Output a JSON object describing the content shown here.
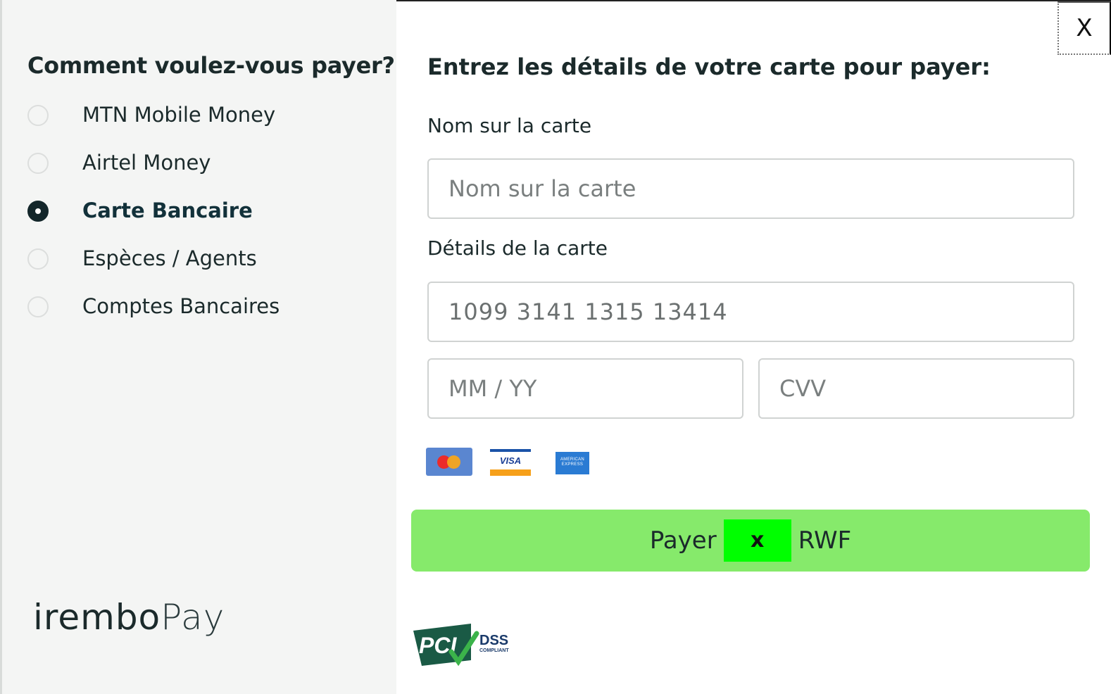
{
  "left": {
    "title": "Comment voulez-vous payer?",
    "options": [
      {
        "label": "MTN Mobile Money",
        "selected": false
      },
      {
        "label": "Airtel Money",
        "selected": false
      },
      {
        "label": "Carte Bancaire",
        "selected": true
      },
      {
        "label": "Espèces / Agents",
        "selected": false
      },
      {
        "label": "Comptes Bancaires",
        "selected": false
      }
    ],
    "logo": {
      "brand": "irembo",
      "suffix": "Pay"
    }
  },
  "right": {
    "title": "Entrez les détails de votre carte pour payer:",
    "name_label": "Nom sur la carte",
    "name_placeholder": "Nom sur la carte",
    "card_label": "Détails de la carte",
    "card_number_value": "1099 3141 1315 13414",
    "expiry_placeholder": "MM / YY",
    "cvv_placeholder": "CVV",
    "card_brands": [
      "Mastercard",
      "VISA",
      "American Express"
    ],
    "visa_text": "VISA",
    "amex_text": "AMERICAN EXPRESS",
    "pay_button": {
      "prefix": "Payer",
      "amount": "x",
      "currency": "RWF"
    },
    "close_label": "X",
    "pci": {
      "main": "PCI",
      "dss": "DSS",
      "compliant": "COMPLIANT"
    }
  },
  "colors": {
    "accent_green": "#86ea6b",
    "amount_highlight": "#00ff00",
    "left_bg": "#f4f5f4",
    "selected_radio": "#13262a"
  }
}
